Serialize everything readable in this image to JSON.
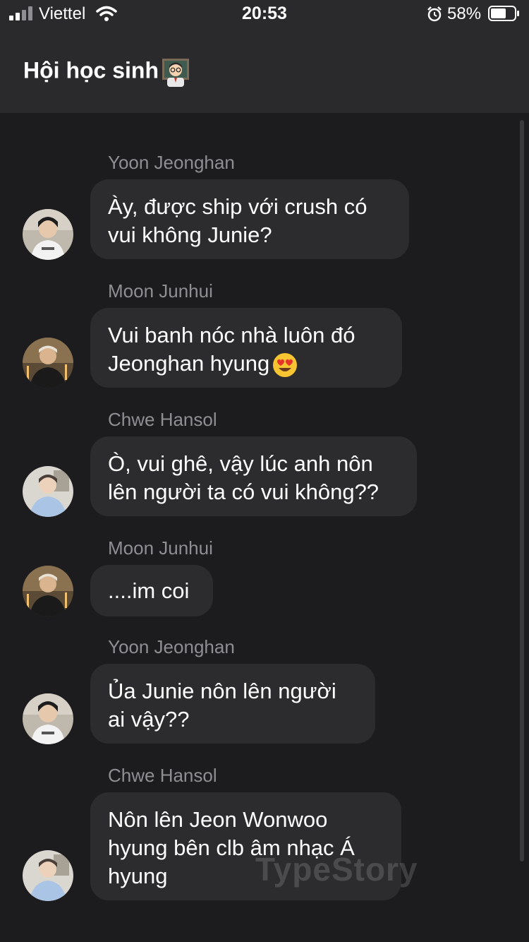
{
  "status": {
    "carrier": "Viettel",
    "time": "20:53",
    "battery_pct": "58%"
  },
  "header": {
    "title": "Hội học sinh",
    "title_icon": "teacher-icon"
  },
  "messages": [
    {
      "sender": "Yoon Jeonghan",
      "lines": [
        "Ày, được ship với crush có",
        "vui không Junie?"
      ],
      "avatar": "avatar-yoon-jeonghan"
    },
    {
      "sender": "Moon Junhui",
      "lines": [
        "Vui banh nóc nhà luôn đó",
        "Jeonghan hyung"
      ],
      "emoji": "heart-eyes-emoji",
      "avatar": "avatar-moon-junhui"
    },
    {
      "sender": "Chwe Hansol",
      "lines": [
        "Ò, vui ghê, vậy lúc anh nôn",
        "lên người ta có vui không??"
      ],
      "avatar": "avatar-chwe-hansol"
    },
    {
      "sender": "Moon Junhui",
      "lines": [
        "....im coi"
      ],
      "avatar": "avatar-moon-junhui"
    },
    {
      "sender": "Yoon Jeonghan",
      "lines": [
        "Ủa Junie nôn lên người",
        "ai vậy??"
      ],
      "avatar": "avatar-yoon-jeonghan"
    },
    {
      "sender": "Chwe Hansol",
      "lines": [
        "Nôn lên Jeon Wonwoo",
        "hyung bên clb âm nhạc Á",
        "hyung"
      ],
      "avatar": "avatar-chwe-hansol"
    }
  ],
  "watermark": "TypeStory"
}
